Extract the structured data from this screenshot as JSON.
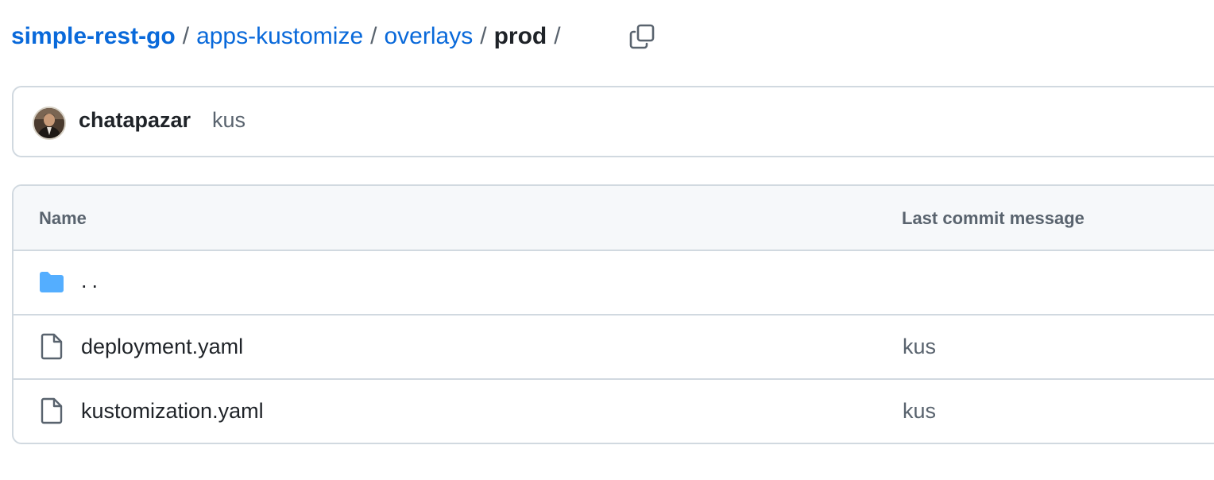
{
  "breadcrumb": {
    "repo": "simple-rest-go",
    "segments": [
      "apps-kustomize",
      "overlays"
    ],
    "current": "prod",
    "separator": "/"
  },
  "copy_button": {
    "icon": "copy-icon"
  },
  "latest_commit": {
    "author": "chatapazar",
    "message": "kus",
    "avatar_icon": "avatar"
  },
  "file_table": {
    "headers": {
      "name": "Name",
      "last_commit_message": "Last commit message"
    },
    "rows": [
      {
        "type": "parent",
        "icon": "folder-icon",
        "name": "..",
        "commit_message": ""
      },
      {
        "type": "file",
        "icon": "file-icon",
        "name": "deployment.yaml",
        "commit_message": "kus"
      },
      {
        "type": "file",
        "icon": "file-icon",
        "name": "kustomization.yaml",
        "commit_message": "kus"
      }
    ]
  },
  "colors": {
    "link": "#0969da",
    "text": "#1f2328",
    "muted": "#59636e",
    "border": "#d1d9e0",
    "header_bg": "#f6f8fa",
    "folder": "#54aeff"
  }
}
